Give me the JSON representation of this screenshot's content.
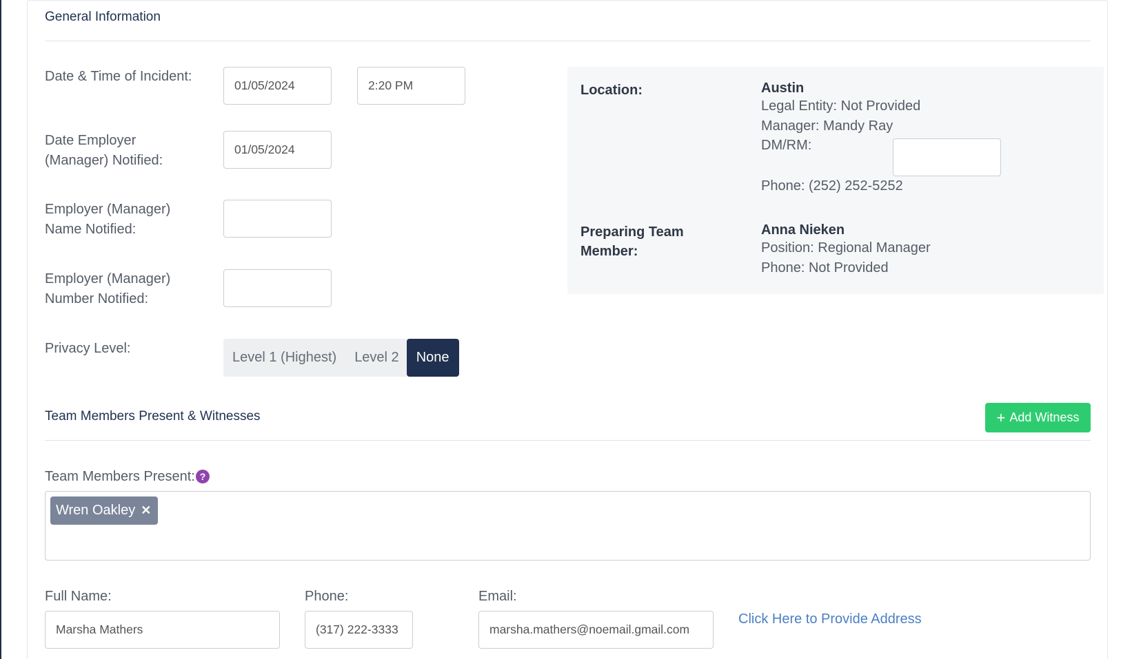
{
  "general": {
    "title": "General Information",
    "date_time_label": "Date & Time of Incident:",
    "incident_date": "01/05/2024",
    "incident_time": "2:20 PM",
    "employer_notified_label_line1": "Date Employer",
    "employer_notified_label_line2": "(Manager) Notified:",
    "employer_notified_date": "01/05/2024",
    "employer_name_label_line1": "Employer (Manager)",
    "employer_name_label_line2": "Name Notified:",
    "employer_name_value": "",
    "employer_number_label_line1": "Employer (Manager)",
    "employer_number_label_line2": "Number Notified:",
    "employer_number_value": "",
    "privacy_label": "Privacy Level:",
    "privacy_options": [
      "Level 1 (Highest)",
      "Level 2",
      "None"
    ],
    "privacy_selected": "None"
  },
  "location": {
    "label": "Location:",
    "name": "Austin",
    "legal_entity": "Legal Entity: Not Provided",
    "manager": "Manager: Mandy Ray",
    "dmrm_label": "DM/RM:",
    "dmrm_value": "",
    "phone": "Phone: (252) 252-5252"
  },
  "preparer": {
    "label_line1": "Preparing Team",
    "label_line2": "Member:",
    "name": "Anna Nieken",
    "position": "Position: Regional Manager",
    "phone": "Phone: Not Provided"
  },
  "witnesses": {
    "title": "Team Members Present & Witnesses",
    "add_button_icon": "+",
    "add_button_label": "Add Witness",
    "present_label": "Team Members Present:",
    "help_icon": "?",
    "present_tags": [
      "Wren Oakley"
    ],
    "tag_remove_icon": "✕",
    "full_name_label": "Full Name:",
    "full_name_value": "Marsha Mathers",
    "phone_label": "Phone:",
    "phone_value": "(317) 222-3333",
    "email_label": "Email:",
    "email_value": "marsha.mathers@noemail.gmail.com",
    "address_link": "Click Here to Provide Address"
  },
  "colors": {
    "primary": "#1f3050",
    "success": "#2ecc71",
    "help": "#8e44ad",
    "chip": "#7a8599",
    "link": "#4a7fc4"
  }
}
